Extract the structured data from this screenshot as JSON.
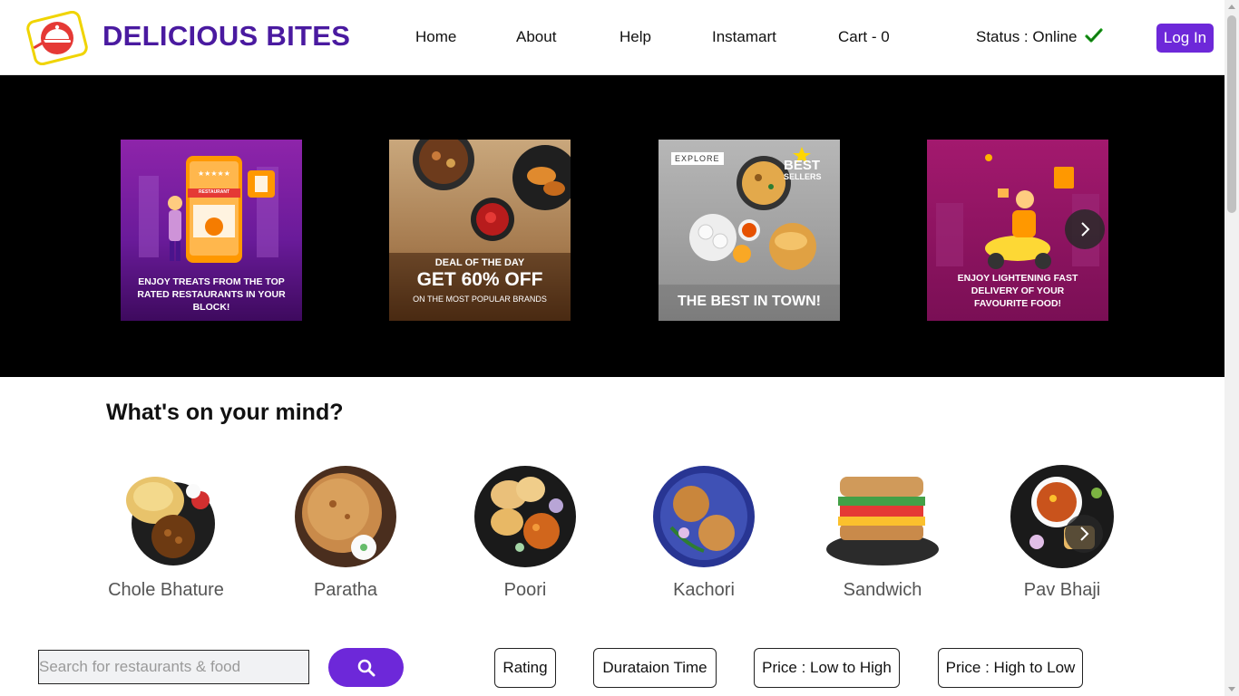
{
  "header": {
    "brand": "DELICIOUS BITES",
    "nav": [
      "Home",
      "About",
      "Help",
      "Instamart",
      "Cart - 0"
    ],
    "status": "Status : Online",
    "login": "Log In"
  },
  "banner": {
    "offers": [
      {
        "text": "ENJOY TREATS FROM THE TOP RATED RESTAURANTS IN YOUR BLOCK!",
        "sign": "RESTAURANT",
        "stars": "★★★★★",
        "bg": "#7b1fa2"
      },
      {
        "line1": "DEAL OF THE DAY",
        "line2": "GET 60% OFF",
        "line3": "ON THE MOST POPULAR BRANDS",
        "bg": "#a0764a"
      },
      {
        "tag": "EXPLORE",
        "badge1": "BEST",
        "badge2": "SELLERS",
        "text": "THE BEST IN TOWN!",
        "bg": "#9a9a9a"
      },
      {
        "text": "ENJOY LIGHTENING FAST DELIVERY OF YOUR FAVOURITE FOOD!",
        "bg": "#8e1566"
      }
    ]
  },
  "mind": {
    "title": "What's on your mind?",
    "dishes": [
      "Chole Bhature",
      "Paratha",
      "Poori",
      "Kachori",
      "Sandwich",
      "Pav Bhaji"
    ]
  },
  "search": {
    "placeholder": "Search for restaurants & food"
  },
  "filters": [
    "Rating",
    "Durataion Time",
    "Price : Low to High",
    "Price : High to Low"
  ],
  "colors": {
    "brand": "#4a1aa0",
    "accent": "#6d28d9",
    "online": "#1a9e1a"
  }
}
